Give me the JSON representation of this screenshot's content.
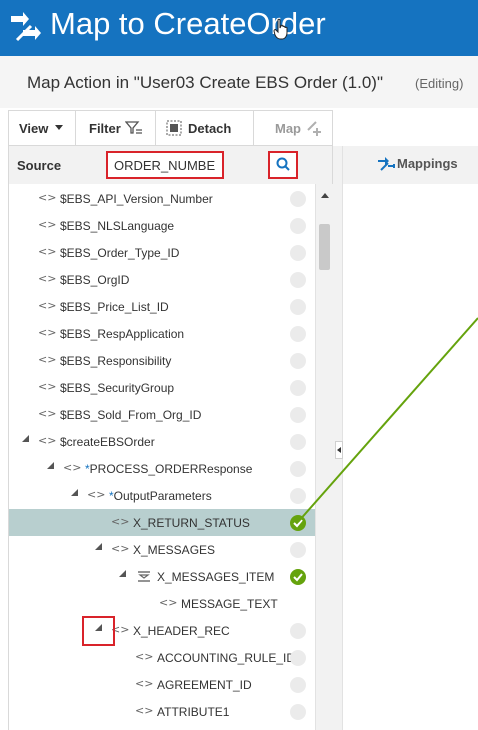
{
  "header": {
    "title": "Map to CreateOrder"
  },
  "subheader": {
    "title": "Map Action in \"User03 Create EBS Order (1.0)\"",
    "status": "(Editing)"
  },
  "toolbar": {
    "view_label": "View",
    "filter_label": "Filter",
    "detach_label": "Detach",
    "map_label": "Map"
  },
  "source": {
    "label": "Source",
    "search_value": "ORDER_NUMBER"
  },
  "mappings": {
    "label": "Mappings"
  },
  "tree": {
    "rows": [
      {
        "label": "$EBS_API_Version_Number",
        "status": "empty"
      },
      {
        "label": "$EBS_NLSLanguage",
        "status": "empty"
      },
      {
        "label": "$EBS_Order_Type_ID",
        "status": "empty"
      },
      {
        "label": "$EBS_OrgID",
        "status": "empty"
      },
      {
        "label": "$EBS_Price_List_ID",
        "status": "empty"
      },
      {
        "label": "$EBS_RespApplication",
        "status": "empty"
      },
      {
        "label": "$EBS_Responsibility",
        "status": "empty"
      },
      {
        "label": "$EBS_SecurityGroup",
        "status": "empty"
      },
      {
        "label": "$EBS_Sold_From_Org_ID",
        "status": "empty"
      },
      {
        "label": "$createEBSOrder",
        "status": "empty"
      },
      {
        "label": "PROCESS_ORDERResponse",
        "required": "*",
        "status": "empty"
      },
      {
        "label": "OutputParameters",
        "required": "*",
        "status": "empty"
      },
      {
        "label": "X_RETURN_STATUS",
        "status": "mapped"
      },
      {
        "label": "X_MESSAGES",
        "status": "empty"
      },
      {
        "label": "X_MESSAGES_ITEM",
        "status": "mapped"
      },
      {
        "label": "MESSAGE_TEXT",
        "status": "none"
      },
      {
        "label": "X_HEADER_REC",
        "status": "empty"
      },
      {
        "label": "ACCOUNTING_RULE_ID",
        "status": "empty"
      },
      {
        "label": "AGREEMENT_ID",
        "status": "empty"
      },
      {
        "label": "ATTRIBUTE1",
        "status": "empty"
      }
    ]
  },
  "colors": {
    "banner": "#1573c0",
    "selected_row": "#b8cfcf",
    "mapped": "#65a30d",
    "highlight": "#d9232a"
  },
  "icons": {
    "header": "map-arrows-icon",
    "element": "element-brackets-icon",
    "repeating_element": "repeating-element-icon",
    "filter": "filter-icon",
    "detach": "detach-icon",
    "search": "search-icon",
    "map": "map-plus-icon",
    "mapped_status": "check-circle-icon"
  }
}
